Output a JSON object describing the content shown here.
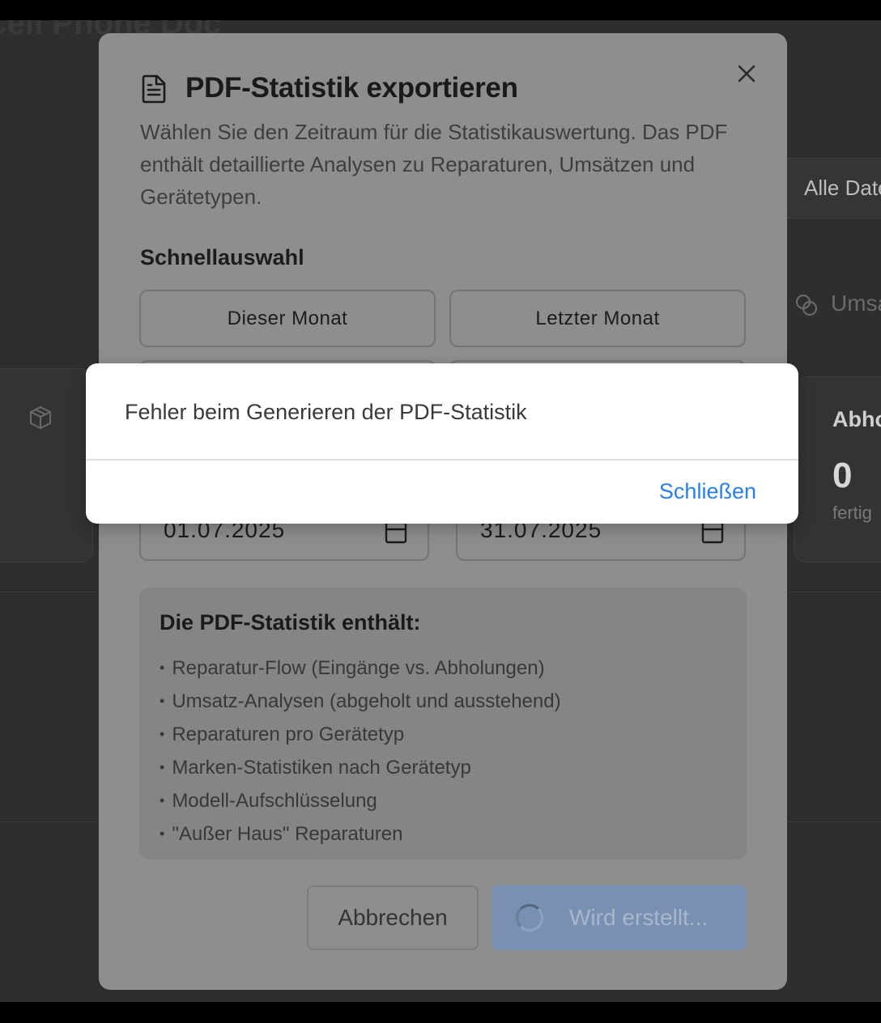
{
  "background": {
    "title": "Cell Phone Doc",
    "filter_label": "Alle Daten",
    "revenue_label": "Umsatz",
    "pickups_label": "Abholungen",
    "pickups_value": "0",
    "pickups_sub": "fertig"
  },
  "dialog": {
    "title": "PDF-Statistik exportieren",
    "description": "Wählen Sie den Zeitraum für die Statistikauswertung. Das PDF enthält detaillierte Analysen zu Reparaturen, Umsätzen und Gerätetypen.",
    "quick_select_label": "Schnellauswahl",
    "quick_buttons": [
      "Dieser Monat",
      "Letzter Monat",
      "",
      ""
    ],
    "date_from": "01.07.2025",
    "date_to": "31.07.2025",
    "info_title": "Die PDF-Statistik enthält:",
    "info_items": [
      "Reparatur-Flow (Eingänge vs. Abholungen)",
      "Umsatz-Analysen (abgeholt und ausstehend)",
      "Reparaturen pro Gerätetyp",
      "Marken-Statistiken nach Gerätetyp",
      "Modell-Aufschlüsselung",
      "\"Außer Haus\" Reparaturen"
    ],
    "cancel_label": "Abbrechen",
    "create_label": "Wird erstellt..."
  },
  "alert": {
    "message": "Fehler beim Generieren der PDF-Statistik",
    "close_label": "Schließen"
  },
  "colors": {
    "accent": "#2a7ee8",
    "create_button": "#7891b3"
  }
}
